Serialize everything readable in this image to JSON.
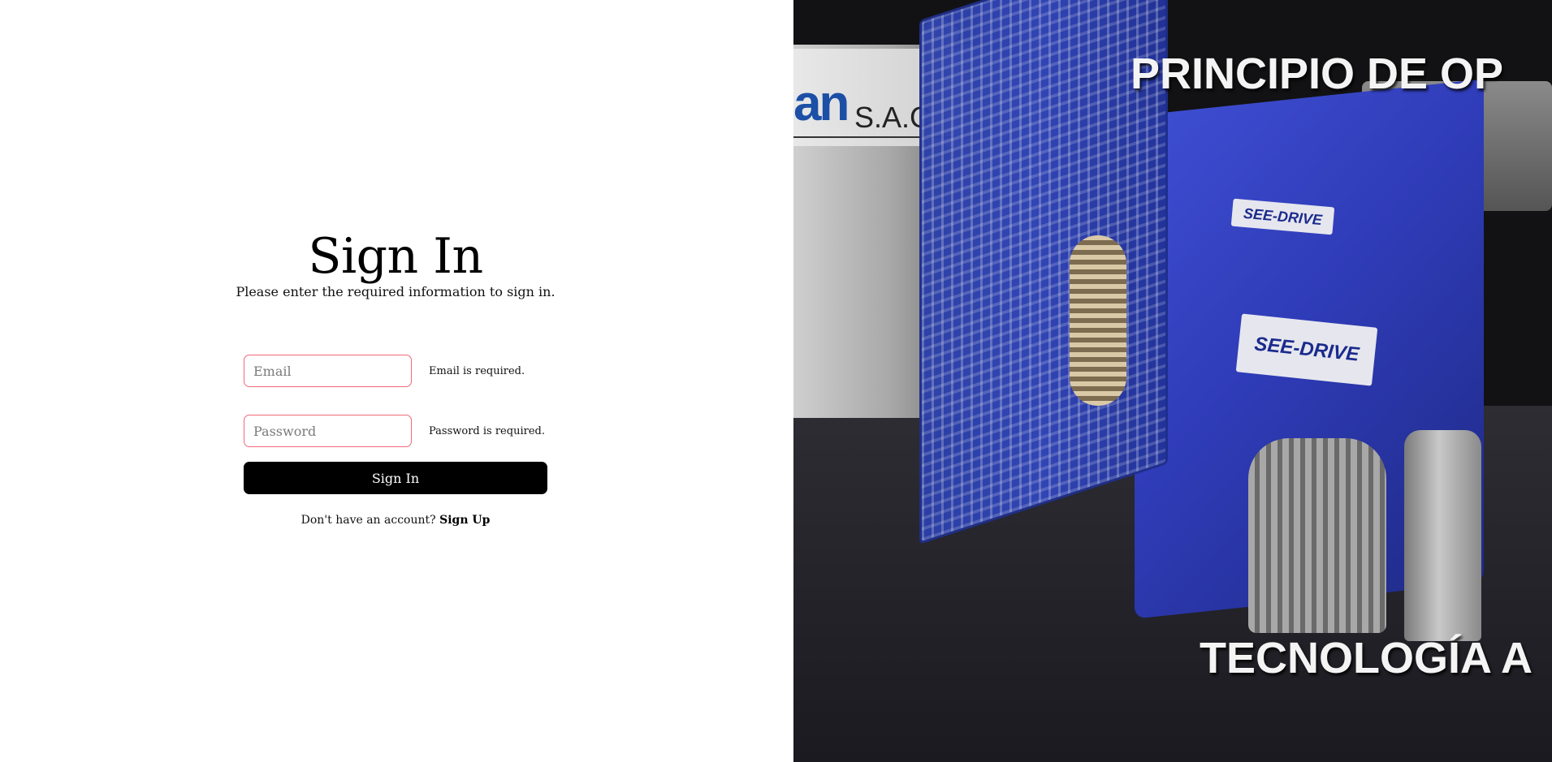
{
  "form": {
    "title": "Sign In",
    "subtitle": "Please enter the required information to sign in.",
    "email_placeholder": "Email",
    "email_error": "Email is required.",
    "password_placeholder": "Password",
    "password_error": "Password is required.",
    "submit_label": "Sign In",
    "signup_prompt": "Don't have an account?",
    "signup_link": "Sign Up"
  },
  "hero": {
    "logo_fragment": "an",
    "logo_suffix": "S.A.C.",
    "headline": "PRINCIPIO DE OP",
    "footer_text": "TECNOLOGÍA A",
    "plate_small": "SEE-DRIVE",
    "plate_large": "SEE-DRIVE"
  },
  "colors": {
    "error_border": "#ef6a7a",
    "button_bg": "#000000",
    "gearbox_blue": "#2f3cb8"
  }
}
